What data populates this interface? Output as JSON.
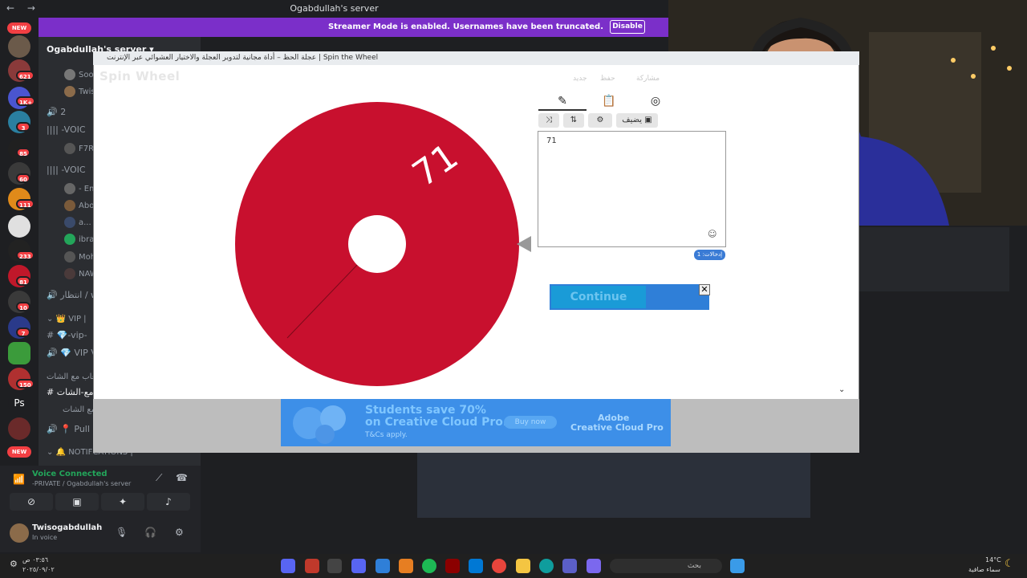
{
  "window": {
    "nav": "← →",
    "title": "Ogabdullah's server"
  },
  "streamer_banner": {
    "message": "Streamer Mode is enabled. Usernames have been truncated.",
    "button": "Disable"
  },
  "server_rail": {
    "new_top": "NEW",
    "badges": [
      "621",
      "1K+",
      "3",
      "85",
      "60",
      "111",
      "233",
      "81",
      "10",
      "7",
      "150"
    ],
    "ps_label": "Ps",
    "new_bottom": "NEW"
  },
  "sidebar": {
    "server_name": "Ogabdullah's server",
    "channels": [
      {
        "text": "Soo"
      },
      {
        "text": "Twis"
      },
      {
        "text": "2"
      },
      {
        "text": "-VOIC"
      },
      {
        "text": "F7R"
      },
      {
        "text": "-VOIC"
      },
      {
        "text": "- Em"
      },
      {
        "text": "Abo"
      },
      {
        "text": "a..."
      },
      {
        "text": "ibra"
      },
      {
        "text": "Moh"
      },
      {
        "text": "NAW"
      },
      {
        "text": "انتظار / w"
      },
      {
        "text": "VIP |"
      },
      {
        "text": "-vip-"
      },
      {
        "text": "VIP V"
      },
      {
        "text": "العاب مع الشات |"
      },
      {
        "text": "مع-الشات"
      },
      {
        "text": "ب مع الشات"
      },
      {
        "text": "Pull"
      },
      {
        "text": "NOTIFCATIONS |"
      }
    ]
  },
  "voice_panel": {
    "status": "Voice Connected",
    "channel": "-PRIVATE / Ogabdullah's server",
    "user": "Twisogabdullah",
    "user_status": "In voice"
  },
  "popup": {
    "bar_title": "عجلة الحظ – أداة مجانية لتدوير العجلة والاختيار العشوائي عبر الإنترنت | Spin the Wheel",
    "logo": "Spin Wheel",
    "nav": [
      "جديد",
      "حفظ",
      "مشاركة"
    ],
    "add_button": "يضيف",
    "entry": "71",
    "entries_count": "إدخالات: 1",
    "wheel_label": "71",
    "continue": "Continue",
    "close": "✕"
  },
  "ad": {
    "line1": "Students save 70%",
    "line2": "on Creative Cloud Pro.",
    "line3": "T&Cs apply.",
    "buy": "Buy now",
    "brand1": "Adobe",
    "brand2": "Creative Cloud Pro"
  },
  "taskbar": {
    "time": "٠٣:٥٦ ص",
    "date": "٢٠٢٥/٠٩/٠٢",
    "search": "بحث",
    "temp": "14°C",
    "weather": "سماء صافية"
  },
  "colors": {
    "wheel": "#c8102e",
    "streamer": "#7b2fc9",
    "continue": "#2f7fd8"
  }
}
